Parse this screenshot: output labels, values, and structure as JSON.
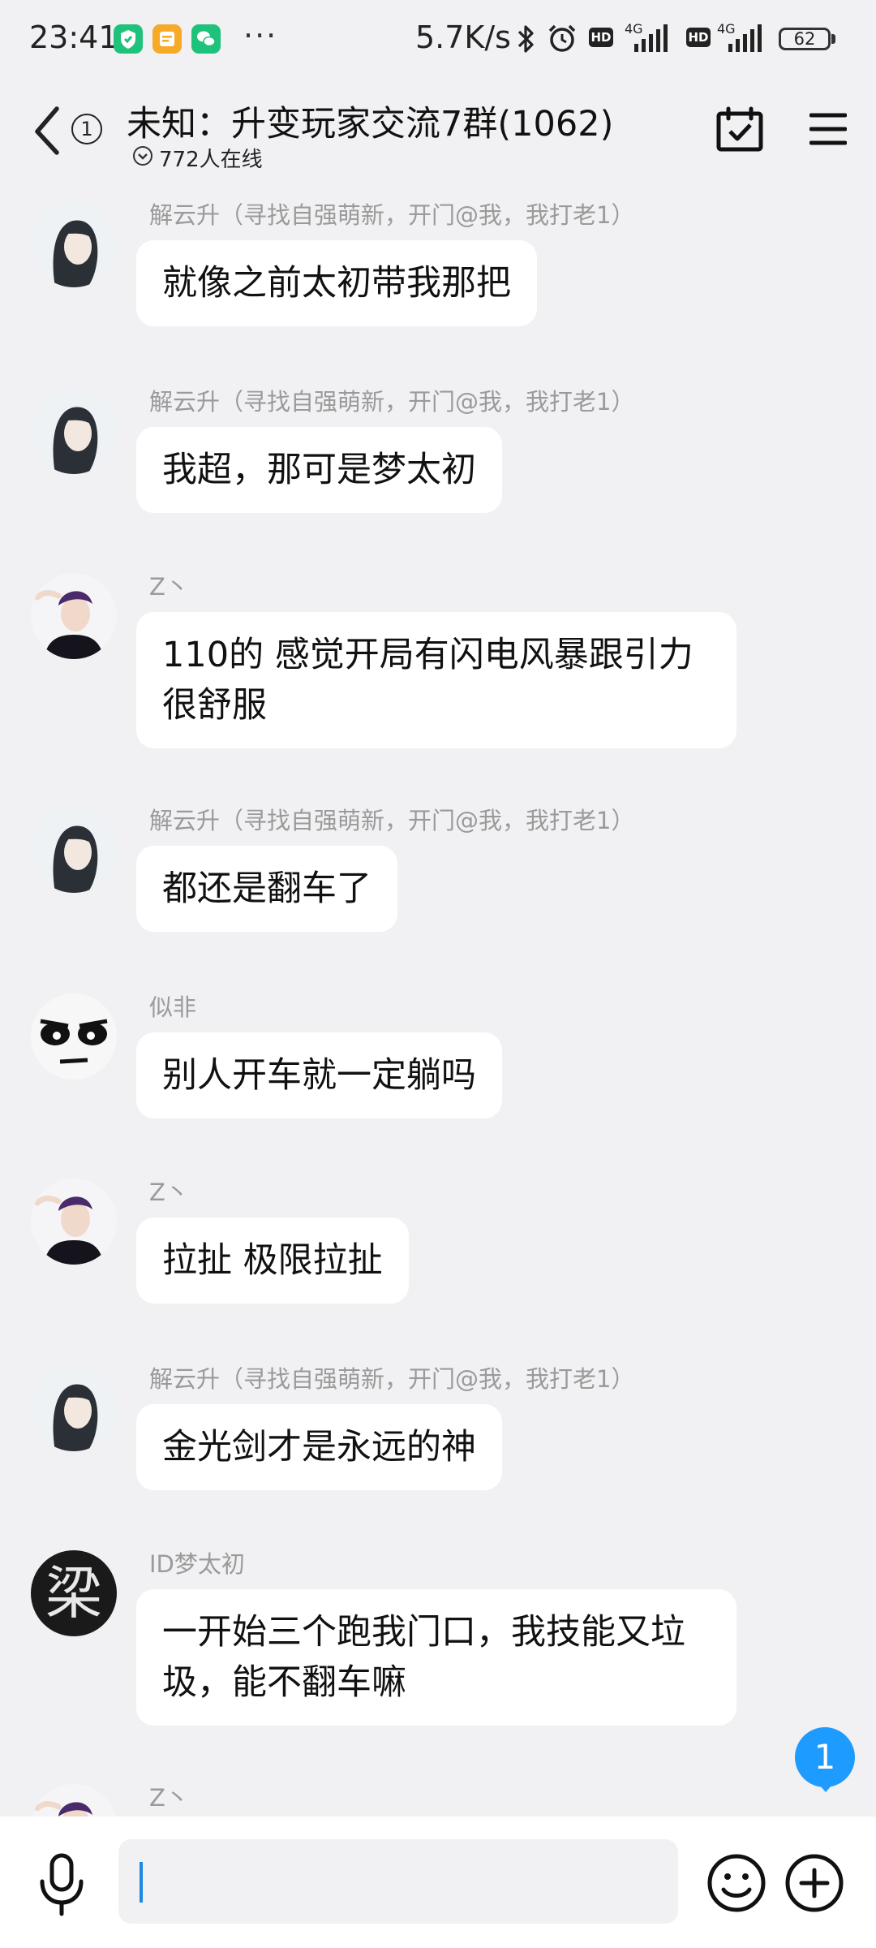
{
  "status_bar": {
    "time": "23:41",
    "more": "···",
    "net_speed": "5.7K/s",
    "hd1": "HD",
    "hd2": "HD",
    "sig1_label": "4G",
    "sig2_label": "4G",
    "battery": "62",
    "icons": [
      "vpn-shield-icon",
      "notes-icon",
      "wechat-icon",
      "bluetooth-icon",
      "alarm-icon"
    ],
    "colors": {
      "shield": "#1ec27a",
      "notes": "#f7a928",
      "wechat": "#1ec27a"
    }
  },
  "header": {
    "title": "未知：升变玩家交流7群(1062)",
    "online": "772人在线",
    "back_badge": "1"
  },
  "messages": [
    {
      "sender": "解云升（寻找自强萌新，开门@我，我打老1）",
      "text": "就像之前太初带我那把",
      "avatar": "avatar-longhair"
    },
    {
      "sender": "解云升（寻找自强萌新，开门@我，我打老1）",
      "text": "我超，那可是梦太初",
      "avatar": "avatar-longhair"
    },
    {
      "sender": "Z丶",
      "text": "110的 感觉开局有闪电风暴跟引力很舒服",
      "avatar": "avatar-boy"
    },
    {
      "sender": "解云升（寻找自强萌新，开门@我，我打老1）",
      "text": "都还是翻车了",
      "avatar": "avatar-longhair"
    },
    {
      "sender": "似非",
      "text": "别人开车就一定躺吗",
      "avatar": "avatar-face"
    },
    {
      "sender": "Z丶",
      "text": "拉扯 极限拉扯",
      "avatar": "avatar-boy"
    },
    {
      "sender": "解云升（寻找自强萌新，开门@我，我打老1）",
      "text": "金光剑才是永远的神",
      "avatar": "avatar-longhair"
    },
    {
      "sender": "ID梦太初",
      "text": "一开始三个跑我门口，我技能又垃圾，能不翻车嘛",
      "avatar": "avatar-calligraphy"
    },
    {
      "sender": "Z丶",
      "text": "",
      "avatar": "avatar-boy"
    }
  ],
  "avatar_glyph": "梁",
  "unread_count": "1",
  "input": {
    "value": "",
    "placeholder": ""
  },
  "accent_color": "#1e9bff"
}
